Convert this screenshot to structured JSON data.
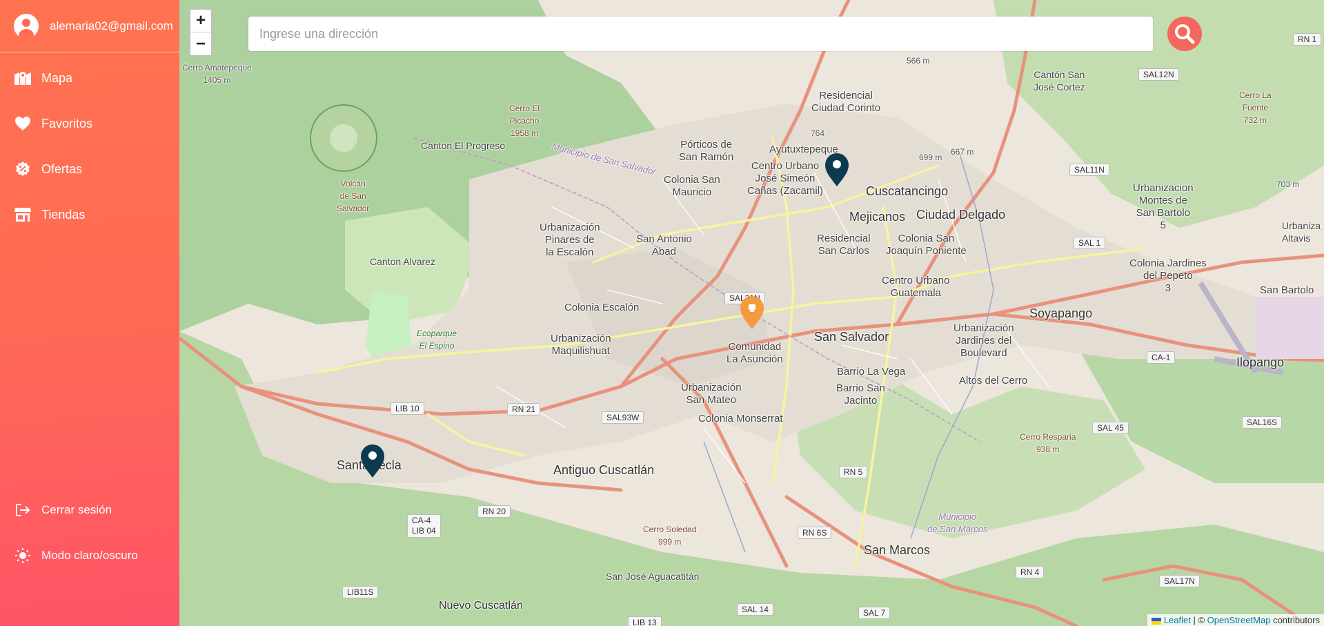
{
  "user": {
    "email": "alemaria02@gmail.com",
    "icon": "user-circle-icon"
  },
  "nav": [
    {
      "label": "Mapa",
      "icon": "map-icon"
    },
    {
      "label": "Favoritos",
      "icon": "heart-icon"
    },
    {
      "label": "Ofertas",
      "icon": "badge-percent-icon"
    },
    {
      "label": "Tiendas",
      "icon": "store-icon"
    }
  ],
  "bottom_nav": [
    {
      "label": "Cerrar sesión",
      "icon": "logout-icon"
    },
    {
      "label": "Modo claro/oscuro",
      "icon": "sun-icon"
    }
  ],
  "search": {
    "placeholder": "Ingrese una dirección"
  },
  "zoom": {
    "in": "+",
    "out": "−"
  },
  "attribution": {
    "leaflet": "Leaflet",
    "sep": " | © ",
    "osm": "OpenStreetMap",
    "suffix": " contributors"
  },
  "colors": {
    "sidebar_top": "#ff7350",
    "sidebar_bottom": "#ff5467",
    "search_button": "#f4675d",
    "marker_store": "#0d3a4f",
    "marker_offer": "#f39b3f"
  },
  "map_labels": {
    "san_salvador": "San Salvador",
    "soyapango": "Soyapango",
    "ilopango": "Ilopango",
    "santa_tecla": "Santa Tecla",
    "antiguo_cuscatlan": "Antiguo Cuscatlán",
    "san_marcos": "San Marcos",
    "mejicanos": "Mejicanos",
    "ciudad_delgado": "Ciudad Delgado",
    "cuscatancingo": "Cuscatancingo",
    "ayutuxtepeque": "Ayutuxtepeque",
    "nuevo_cuscatlan": "Nuevo Cuscatlán",
    "colonia_escalon": "Colonia Escalón",
    "colonia_monserrat": "Colonia Monserrat",
    "barrio_la_vega": "Barrio La Vega",
    "barrio_san_jacinto": "Barrio San\nJacinto",
    "comunidad_la_asuncion": "Comunidad\nLa Asunción",
    "urb_san_mateo": "Urbanización\nSan Mateo",
    "urb_maquilishuat": "Urbanización\nMaquilishuat",
    "urb_pinares": "Urbanización\nPinares de\nla Escalón",
    "san_antonio_abad": "San Antonio\nAbad",
    "colonia_san_mauricio": "Colonia San\nMauricio",
    "porticos": "Pórticos de\nSan Ramón",
    "centro_urbano_jose": "Centro Urbano\nJosé Simeón\nCañas (Zacamil)",
    "residencial_corinto": "Residencial\nCiudad Corinto",
    "residencial_san_carlos": "Residencial\nSan Carlos",
    "colonia_san_joaquin": "Colonia San\nJoaquín Poniente",
    "centro_urbano_guatemala": "Centro Urbano\nGuatemala",
    "urb_jardines": "Urbanización\nJardines del\nBoulevard",
    "altos_del_cerro": "Altos del Cerro",
    "canton_el_progreso": "Canton El Progreso",
    "canton_alvarez": "Canton Alvarez",
    "canton_san_jose": "Cantón San\nJosé Cortez",
    "urb_montes": "Urbanizacion\nMontes de\nSan Bartolo\n5",
    "colonia_jardines_pepeto": "Colonia Jardines\ndel Pepeto\n3",
    "san_bartolo": "San Bartolo",
    "san_jose_aguacatitan": "San José Aguacatitán",
    "urbaniza_altavis": "Urbaniza\nAltavis",
    "cerro_amatepeque": "Cerro Amatepeque\n1405 m",
    "cerro_el_picacho": "Cerro El\nPicacho\n1958 m",
    "volcan": "Volcán\nde San\nSalvador",
    "cerro_resparia": "Cerro Resparia\n938 m",
    "cerro_soledad": "Cerro Soledad\n999 m",
    "cerro_la_fuente": "Cerro La\nFuente\n732 m",
    "ecoparque": "Ecoparque\nEl Espino",
    "mun_san_salvador": "Municipio de San Salvador",
    "mun_san_marcos": "Municipio\nde San Marcos",
    "elev_566": "566 m",
    "elev_764": "764",
    "elev_699": "699 m",
    "elev_667": "667 m",
    "elev_703": "703 m"
  },
  "road_shields": [
    "RN 1",
    "SAL12N",
    "SAL11N",
    "SAL 1",
    "CA-1",
    "SAL 45",
    "SAL16S",
    "SAL17N",
    "RN 4",
    "RN 5",
    "RN 6S",
    "SAL 7",
    "SAL 14",
    "LIB 13",
    "LIB11S",
    "CA-4\nLIB 04",
    "RN 20",
    "RN 21",
    "SAL93W",
    "LIB 10",
    "SAL31N"
  ]
}
